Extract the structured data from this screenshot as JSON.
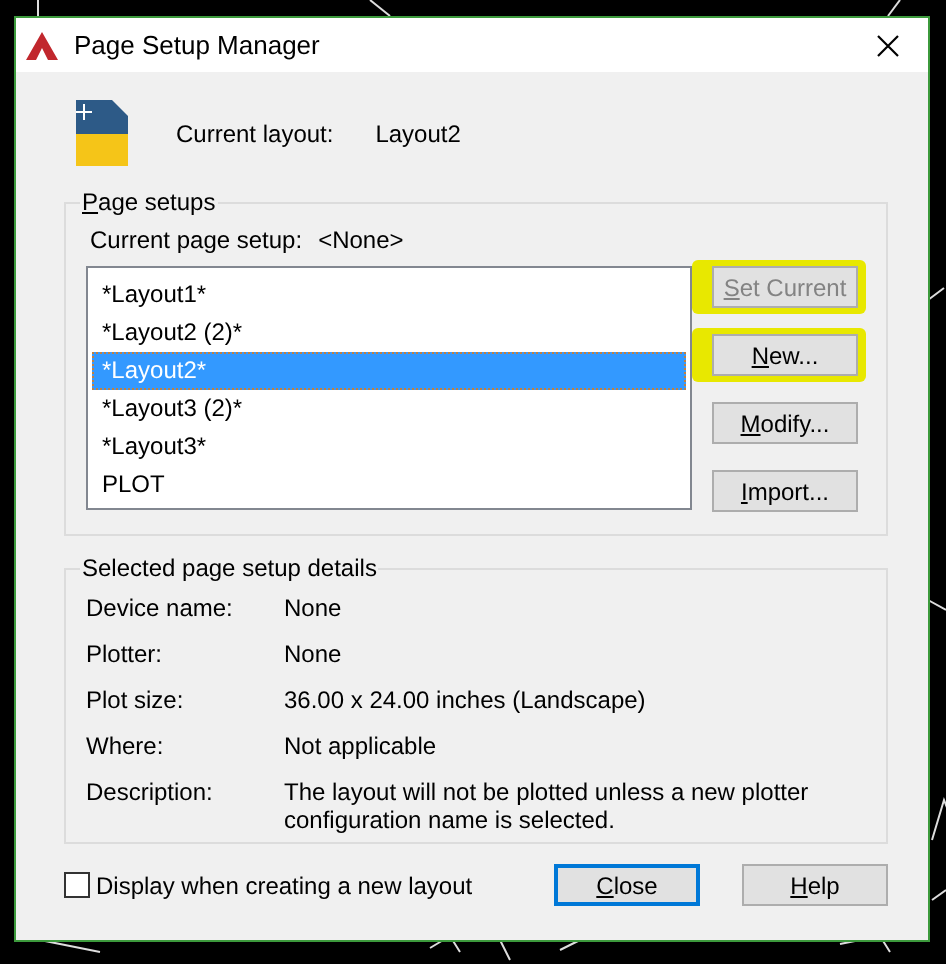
{
  "window": {
    "title": "Page Setup Manager"
  },
  "current_layout": {
    "label": "Current layout:",
    "value": "Layout2"
  },
  "page_setups": {
    "title": "Page setups",
    "current_label": "Current page setup:",
    "current_value": "<None>",
    "items": [
      {
        "label": "*Layout1*",
        "selected": false
      },
      {
        "label": "*Layout2 (2)*",
        "selected": false
      },
      {
        "label": "*Layout2*",
        "selected": true
      },
      {
        "label": "*Layout3 (2)*",
        "selected": false
      },
      {
        "label": "*Layout3*",
        "selected": false
      },
      {
        "label": "PLOT",
        "selected": false
      }
    ],
    "buttons": [
      {
        "label": "Set Current",
        "disabled": true,
        "highlighted": true
      },
      {
        "label": "New...",
        "disabled": false,
        "highlighted": true
      },
      {
        "label": "Modify...",
        "disabled": false,
        "highlighted": false
      },
      {
        "label": "Import...",
        "disabled": false,
        "highlighted": false
      }
    ]
  },
  "details": {
    "title": "Selected page setup details",
    "rows": [
      {
        "label": "Device name:",
        "value": "None"
      },
      {
        "label": "Plotter:",
        "value": "None"
      },
      {
        "label": "Plot size:",
        "value": "36.00 x 24.00 inches (Landscape)"
      },
      {
        "label": "Where:",
        "value": "Not applicable"
      },
      {
        "label": "Description:",
        "value": "The layout will not be plotted unless a new plotter configuration name is selected."
      }
    ]
  },
  "display_checkbox": {
    "label": "Display when creating a new layout",
    "checked": false
  },
  "footer_buttons": [
    {
      "label": "Close",
      "default": true
    },
    {
      "label": "Help",
      "default": false
    }
  ]
}
